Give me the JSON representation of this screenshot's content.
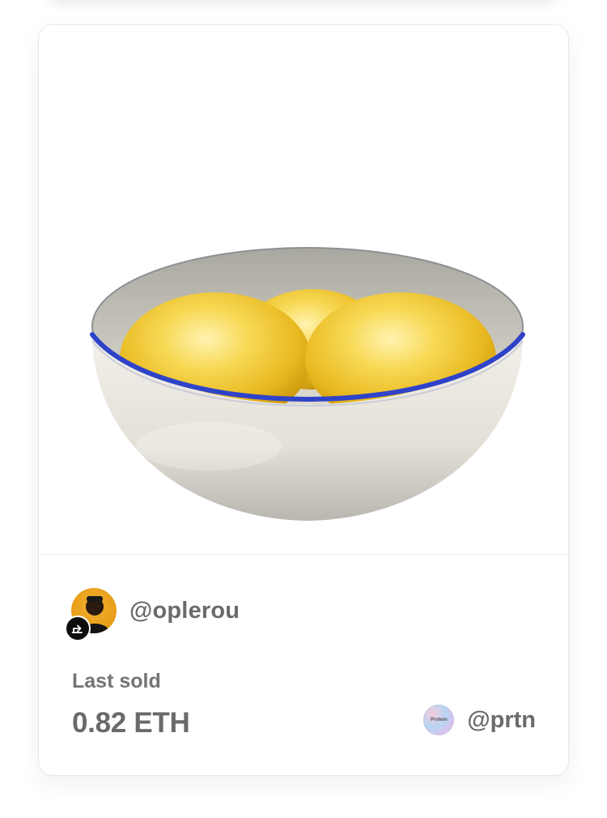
{
  "nft": {
    "artwork_name": "bowl-of-golden-eggs"
  },
  "creator": {
    "handle": "@oplerou",
    "badge_icon": "creator-badge-icon"
  },
  "sale": {
    "label": "Last sold",
    "price": "0.82 ETH"
  },
  "collector": {
    "avatar_text": "Protein",
    "handle": "@prtn"
  },
  "colors": {
    "bowl_rim": "#2f43c9",
    "egg_gold": "#f3c93a",
    "text_primary": "#6b6b6b"
  }
}
